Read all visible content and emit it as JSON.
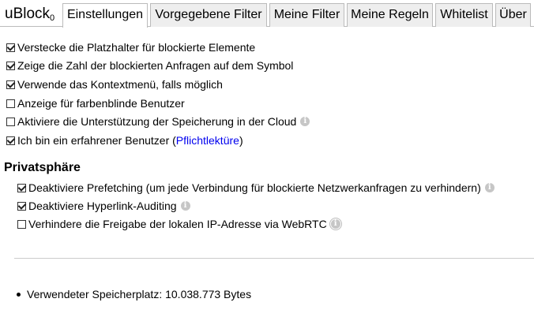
{
  "app": {
    "name": "uBlock",
    "subscript": "0"
  },
  "tabs": [
    {
      "label": "Einstellungen",
      "active": true
    },
    {
      "label": "Vorgegebene Filter",
      "active": false
    },
    {
      "label": "Meine Filter",
      "active": false
    },
    {
      "label": "Meine Regeln",
      "active": false
    },
    {
      "label": "Whitelist",
      "active": false
    },
    {
      "label": "Über",
      "active": false
    }
  ],
  "settings": {
    "hide_placeholders": {
      "label": "Verstecke die Platzhalter für blockierte Elemente",
      "checked": true
    },
    "show_icon_badge": {
      "label": "Zeige die Zahl der blockierten Anfragen auf dem Symbol",
      "checked": true
    },
    "context_menu": {
      "label": "Verwende das Kontextmenü, falls möglich",
      "checked": true
    },
    "color_blind": {
      "label": "Anzeige für farbenblinde Benutzer",
      "checked": false
    },
    "cloud_storage": {
      "label": "Aktiviere die Unterstützung der Speicherung in der Cloud",
      "checked": false
    },
    "advanced_user": {
      "label_before": "Ich bin ein erfahrener Benutzer (",
      "link": "Pflichtlektüre",
      "label_after": ")",
      "checked": true
    }
  },
  "privacy": {
    "title": "Privatsphäre",
    "prefetching": {
      "label": "Deaktiviere Prefetching (um jede Verbindung für blockierte Netzwerkanfragen zu verhindern)",
      "checked": true
    },
    "hyperlink_auditing": {
      "label": "Deaktiviere Hyperlink-Auditing",
      "checked": true
    },
    "webrtc": {
      "label": "Verhindere die Freigabe der lokalen IP-Adresse via WebRTC",
      "checked": false
    }
  },
  "storage": {
    "label": "Verwendeter Speicherplatz: 10.038.773 Bytes"
  },
  "icons": {
    "info": "info-icon",
    "checkbox": "checkbox"
  }
}
